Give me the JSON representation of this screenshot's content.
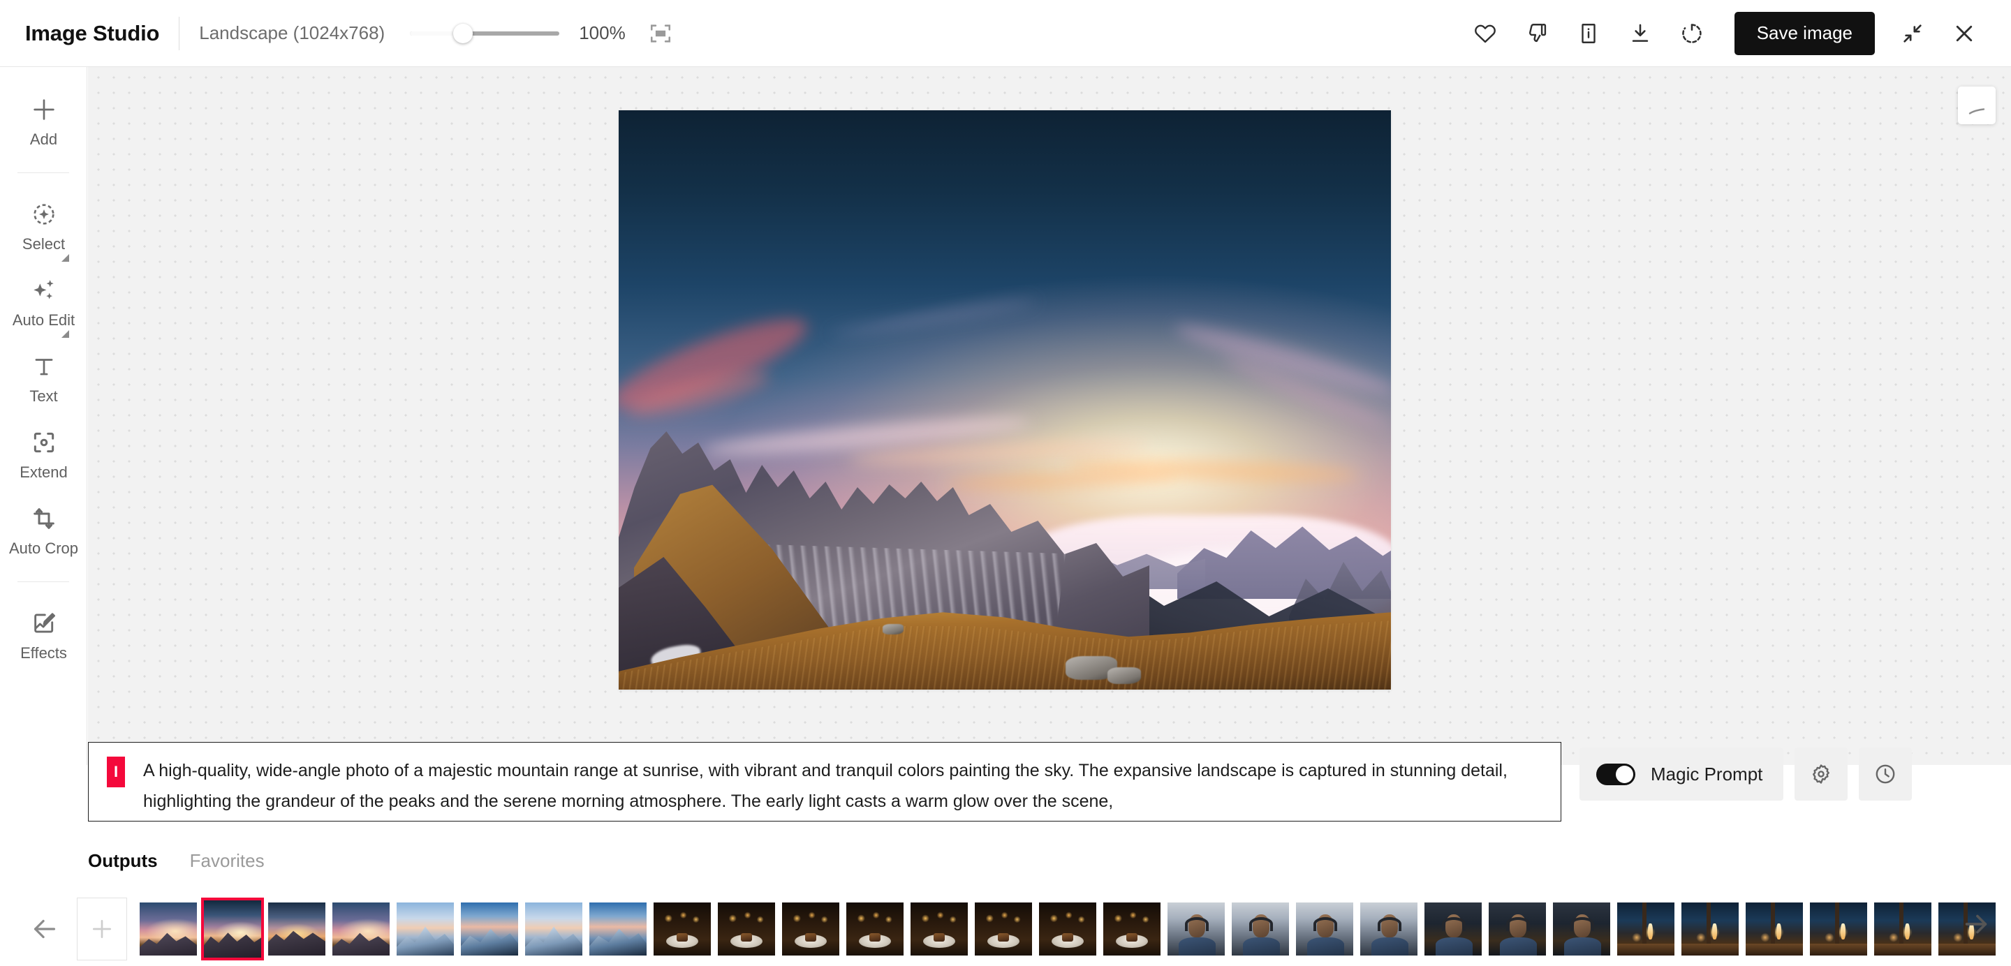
{
  "app": {
    "title": "Image Studio"
  },
  "topbar": {
    "aspect_label": "Landscape (1024x768)",
    "zoom_percent": "100%",
    "zoom_value": 100,
    "fit_icon": "fit-to-screen-icon",
    "actions": [
      {
        "name": "favorite-button",
        "icon": "heart-icon"
      },
      {
        "name": "dislike-button",
        "icon": "thumbs-down-icon"
      },
      {
        "name": "info-button",
        "icon": "info-icon"
      },
      {
        "name": "download-button",
        "icon": "download-icon"
      },
      {
        "name": "regenerate-button",
        "icon": "refresh-icon"
      }
    ],
    "save_label": "Save image",
    "collapse_icon": "collapse-arrows-icon",
    "close_icon": "close-icon"
  },
  "sidebar": {
    "items": [
      {
        "label": "Add",
        "icon": "plus-icon",
        "expandable": false
      },
      {
        "label": "Select",
        "icon": "select-target-icon",
        "expandable": true
      },
      {
        "label": "Auto Edit",
        "icon": "sparkles-icon",
        "expandable": true
      },
      {
        "label": "Text",
        "icon": "text-t-icon",
        "expandable": false
      },
      {
        "label": "Extend",
        "icon": "extend-frame-icon",
        "expandable": false
      },
      {
        "label": "Auto Crop",
        "icon": "auto-crop-icon",
        "expandable": false
      },
      {
        "label": "Effects",
        "icon": "effects-image-icon",
        "expandable": false
      }
    ]
  },
  "canvas": {
    "image_alt": "Mountain range at sunrise with sea of clouds",
    "overlay_card_icon": "eraser-icon"
  },
  "prompt": {
    "badge": "I",
    "badge_color": "#f4093b",
    "text": "A high-quality, wide-angle photo of a majestic mountain range at sunrise, with vibrant and tranquil colors painting the sky. The expansive landscape is captured in stunning detail, highlighting the grandeur of the peaks and the serene morning atmosphere. The early light casts a warm glow over the scene,",
    "magic_prompt_label": "Magic Prompt",
    "magic_prompt_on": true,
    "settings_icon": "gear-icon",
    "history_icon": "clock-icon"
  },
  "tabs": {
    "items": [
      {
        "label": "Outputs",
        "active": true
      },
      {
        "label": "Favorites",
        "active": false
      }
    ]
  },
  "filmstrip": {
    "prev_icon": "arrow-left-icon",
    "next_icon": "arrow-right-icon",
    "add_icon": "plus-icon",
    "selected_index": 1,
    "thumbnails": [
      {
        "kind": "mtn1",
        "selected": false
      },
      {
        "kind": "mtn2",
        "selected": true
      },
      {
        "kind": "mtn3",
        "selected": false
      },
      {
        "kind": "mtn1",
        "selected": false
      },
      {
        "kind": "snow",
        "selected": false
      },
      {
        "kind": "snow2",
        "selected": false
      },
      {
        "kind": "snow",
        "selected": false
      },
      {
        "kind": "snow2",
        "selected": false
      },
      {
        "kind": "food",
        "selected": false
      },
      {
        "kind": "food",
        "selected": false
      },
      {
        "kind": "food",
        "selected": false
      },
      {
        "kind": "food",
        "selected": false
      },
      {
        "kind": "food",
        "selected": false
      },
      {
        "kind": "food",
        "selected": false
      },
      {
        "kind": "food",
        "selected": false
      },
      {
        "kind": "food",
        "selected": false
      },
      {
        "kind": "person",
        "selected": false
      },
      {
        "kind": "person",
        "selected": false
      },
      {
        "kind": "person",
        "selected": false
      },
      {
        "kind": "person",
        "selected": false
      },
      {
        "kind": "persondark",
        "selected": false
      },
      {
        "kind": "persondark",
        "selected": false
      },
      {
        "kind": "persondark",
        "selected": false
      },
      {
        "kind": "candle",
        "selected": false
      },
      {
        "kind": "candle",
        "selected": false
      },
      {
        "kind": "candle",
        "selected": false
      },
      {
        "kind": "candle",
        "selected": false
      },
      {
        "kind": "candle",
        "selected": false
      },
      {
        "kind": "candle",
        "selected": false
      }
    ]
  }
}
